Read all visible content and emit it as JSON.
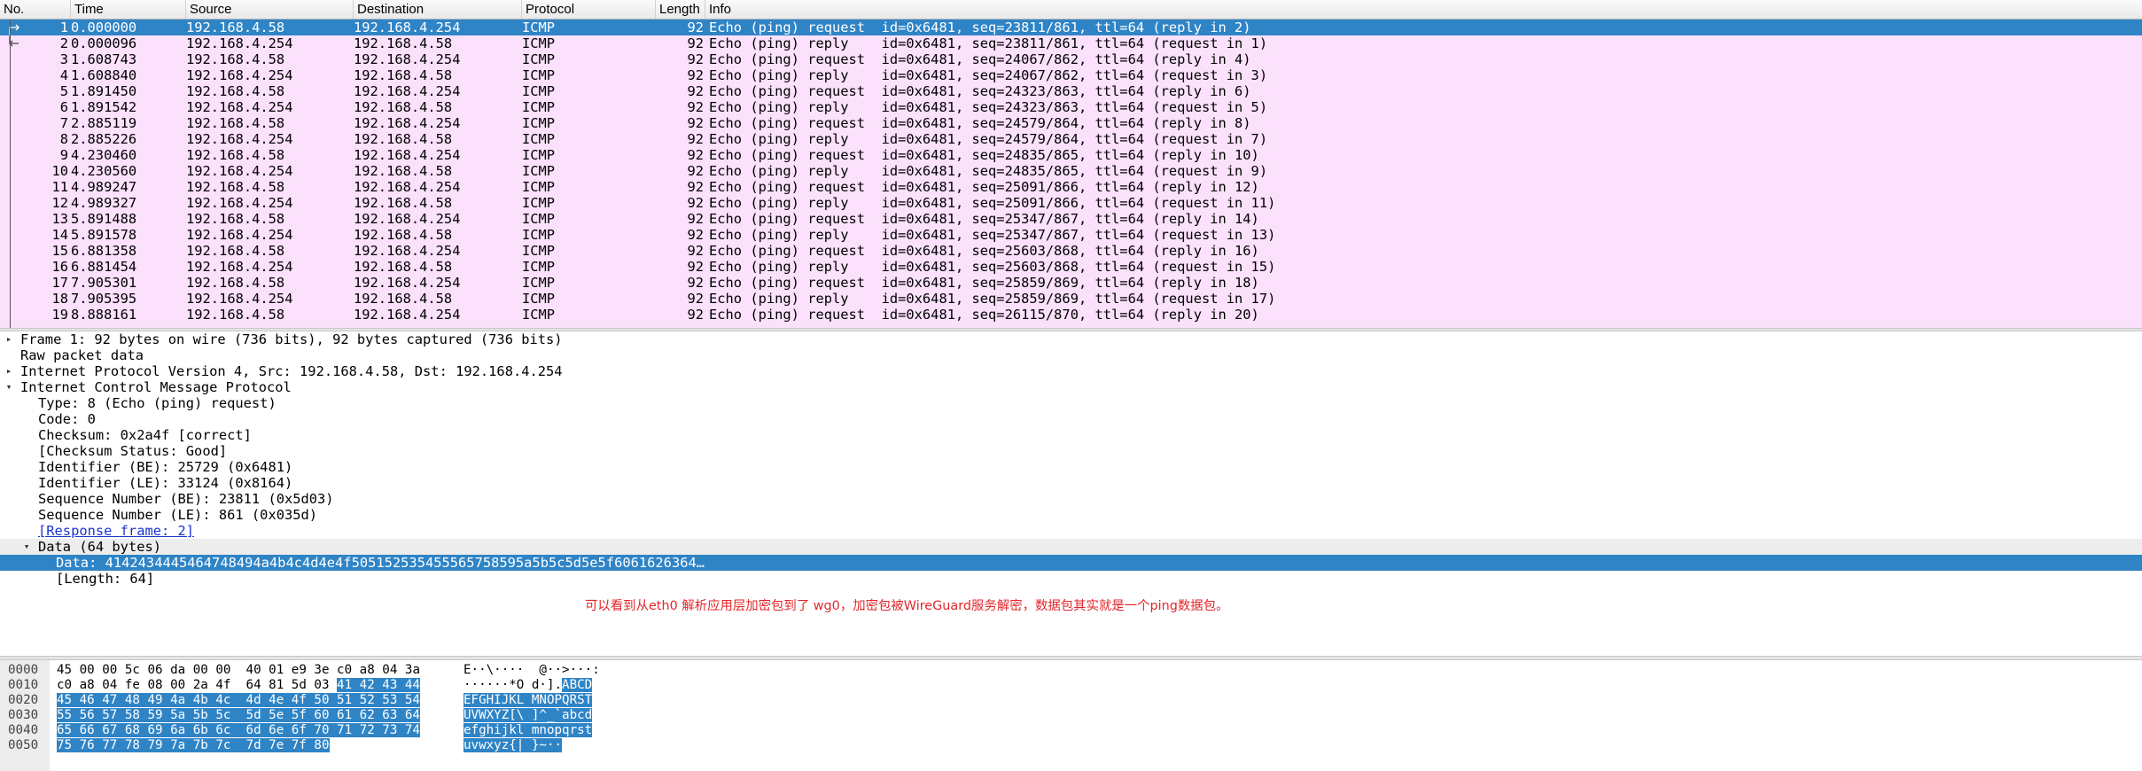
{
  "packet_list": {
    "columns": {
      "no": "No.",
      "time": "Time",
      "source": "Source",
      "destination": "Destination",
      "protocol": "Protocol",
      "length": "Length",
      "info": "Info"
    },
    "rows": [
      {
        "no": "1",
        "time": "0.000000",
        "src": "192.168.4.58",
        "dst": "192.168.4.254",
        "proto": "ICMP",
        "len": "92",
        "info": "Echo (ping) request  id=0x6481, seq=23811/861, ttl=64 (reply in 2)"
      },
      {
        "no": "2",
        "time": "0.000096",
        "src": "192.168.4.254",
        "dst": "192.168.4.58",
        "proto": "ICMP",
        "len": "92",
        "info": "Echo (ping) reply    id=0x6481, seq=23811/861, ttl=64 (request in 1)"
      },
      {
        "no": "3",
        "time": "1.608743",
        "src": "192.168.4.58",
        "dst": "192.168.4.254",
        "proto": "ICMP",
        "len": "92",
        "info": "Echo (ping) request  id=0x6481, seq=24067/862, ttl=64 (reply in 4)"
      },
      {
        "no": "4",
        "time": "1.608840",
        "src": "192.168.4.254",
        "dst": "192.168.4.58",
        "proto": "ICMP",
        "len": "92",
        "info": "Echo (ping) reply    id=0x6481, seq=24067/862, ttl=64 (request in 3)"
      },
      {
        "no": "5",
        "time": "1.891450",
        "src": "192.168.4.58",
        "dst": "192.168.4.254",
        "proto": "ICMP",
        "len": "92",
        "info": "Echo (ping) request  id=0x6481, seq=24323/863, ttl=64 (reply in 6)"
      },
      {
        "no": "6",
        "time": "1.891542",
        "src": "192.168.4.254",
        "dst": "192.168.4.58",
        "proto": "ICMP",
        "len": "92",
        "info": "Echo (ping) reply    id=0x6481, seq=24323/863, ttl=64 (request in 5)"
      },
      {
        "no": "7",
        "time": "2.885119",
        "src": "192.168.4.58",
        "dst": "192.168.4.254",
        "proto": "ICMP",
        "len": "92",
        "info": "Echo (ping) request  id=0x6481, seq=24579/864, ttl=64 (reply in 8)"
      },
      {
        "no": "8",
        "time": "2.885226",
        "src": "192.168.4.254",
        "dst": "192.168.4.58",
        "proto": "ICMP",
        "len": "92",
        "info": "Echo (ping) reply    id=0x6481, seq=24579/864, ttl=64 (request in 7)"
      },
      {
        "no": "9",
        "time": "4.230460",
        "src": "192.168.4.58",
        "dst": "192.168.4.254",
        "proto": "ICMP",
        "len": "92",
        "info": "Echo (ping) request  id=0x6481, seq=24835/865, ttl=64 (reply in 10)"
      },
      {
        "no": "10",
        "time": "4.230560",
        "src": "192.168.4.254",
        "dst": "192.168.4.58",
        "proto": "ICMP",
        "len": "92",
        "info": "Echo (ping) reply    id=0x6481, seq=24835/865, ttl=64 (request in 9)"
      },
      {
        "no": "11",
        "time": "4.989247",
        "src": "192.168.4.58",
        "dst": "192.168.4.254",
        "proto": "ICMP",
        "len": "92",
        "info": "Echo (ping) request  id=0x6481, seq=25091/866, ttl=64 (reply in 12)"
      },
      {
        "no": "12",
        "time": "4.989327",
        "src": "192.168.4.254",
        "dst": "192.168.4.58",
        "proto": "ICMP",
        "len": "92",
        "info": "Echo (ping) reply    id=0x6481, seq=25091/866, ttl=64 (request in 11)"
      },
      {
        "no": "13",
        "time": "5.891488",
        "src": "192.168.4.58",
        "dst": "192.168.4.254",
        "proto": "ICMP",
        "len": "92",
        "info": "Echo (ping) request  id=0x6481, seq=25347/867, ttl=64 (reply in 14)"
      },
      {
        "no": "14",
        "time": "5.891578",
        "src": "192.168.4.254",
        "dst": "192.168.4.58",
        "proto": "ICMP",
        "len": "92",
        "info": "Echo (ping) reply    id=0x6481, seq=25347/867, ttl=64 (request in 13)"
      },
      {
        "no": "15",
        "time": "6.881358",
        "src": "192.168.4.58",
        "dst": "192.168.4.254",
        "proto": "ICMP",
        "len": "92",
        "info": "Echo (ping) request  id=0x6481, seq=25603/868, ttl=64 (reply in 16)"
      },
      {
        "no": "16",
        "time": "6.881454",
        "src": "192.168.4.254",
        "dst": "192.168.4.58",
        "proto": "ICMP",
        "len": "92",
        "info": "Echo (ping) reply    id=0x6481, seq=25603/868, ttl=64 (request in 15)"
      },
      {
        "no": "17",
        "time": "7.905301",
        "src": "192.168.4.58",
        "dst": "192.168.4.254",
        "proto": "ICMP",
        "len": "92",
        "info": "Echo (ping) request  id=0x6481, seq=25859/869, ttl=64 (reply in 18)"
      },
      {
        "no": "18",
        "time": "7.905395",
        "src": "192.168.4.254",
        "dst": "192.168.4.58",
        "proto": "ICMP",
        "len": "92",
        "info": "Echo (ping) reply    id=0x6481, seq=25859/869, ttl=64 (request in 17)"
      },
      {
        "no": "19",
        "time": "8.888161",
        "src": "192.168.4.58",
        "dst": "192.168.4.254",
        "proto": "ICMP",
        "len": "92",
        "info": "Echo (ping) request  id=0x6481, seq=26115/870, ttl=64 (reply in 20)"
      }
    ],
    "selected_index": 0,
    "row_color": "#fbe1fb",
    "selected_color": "#2f84c6"
  },
  "details": {
    "rows": [
      {
        "indent": 0,
        "arrow": "collapsed",
        "text": "Frame 1: 92 bytes on wire (736 bits), 92 bytes captured (736 bits)"
      },
      {
        "indent": 0,
        "arrow": "none",
        "text": "Raw packet data"
      },
      {
        "indent": 0,
        "arrow": "collapsed",
        "text": "Internet Protocol Version 4, Src: 192.168.4.58, Dst: 192.168.4.254"
      },
      {
        "indent": 0,
        "arrow": "expanded",
        "text": "Internet Control Message Protocol"
      },
      {
        "indent": 1,
        "arrow": "none",
        "text": "Type: 8 (Echo (ping) request)"
      },
      {
        "indent": 1,
        "arrow": "none",
        "text": "Code: 0"
      },
      {
        "indent": 1,
        "arrow": "none",
        "text": "Checksum: 0x2a4f [correct]"
      },
      {
        "indent": 1,
        "arrow": "none",
        "text": "[Checksum Status: Good]"
      },
      {
        "indent": 1,
        "arrow": "none",
        "text": "Identifier (BE): 25729 (0x6481)"
      },
      {
        "indent": 1,
        "arrow": "none",
        "text": "Identifier (LE): 33124 (0x8164)"
      },
      {
        "indent": 1,
        "arrow": "none",
        "text": "Sequence Number (BE): 23811 (0x5d03)"
      },
      {
        "indent": 1,
        "arrow": "none",
        "text": "Sequence Number (LE): 861 (0x035d)"
      },
      {
        "indent": 1,
        "arrow": "none",
        "text": "[Response frame: 2]",
        "link": true
      },
      {
        "indent": 1,
        "arrow": "expanded",
        "text": "Data (64 bytes)",
        "highlight": true
      },
      {
        "indent": 2,
        "arrow": "none",
        "text": "Data: 4142434445464748494a4b4c4d4e4f505152535455565758595a5b5c5d5e5f6061626364…",
        "selected": true
      },
      {
        "indent": 2,
        "arrow": "none",
        "text": "[Length: 64]"
      }
    ],
    "note": "可以看到从eth0 解析应用层加密包到了 wg0，加密包被WireGuard服务解密，数据包其实就是一个ping数据包。"
  },
  "bytes": {
    "rows": [
      {
        "offset": "0000",
        "hex_plain": "45 00 00 5c 06 da 00 00  40 01 e9 3e c0 a8 04 3a",
        "hex_sel": "",
        "ascii_plain": "E··\\····  @··>···:",
        "ascii_sel": ""
      },
      {
        "offset": "0010",
        "hex_plain": "c0 a8 04 fe 08 00 2a 4f  64 81 5d 03 ",
        "hex_sel": "41 42 43 44",
        "ascii_plain": "······*O d·].",
        "ascii_sel": "ABCD"
      },
      {
        "offset": "0020",
        "hex_plain": "",
        "hex_sel": "45 46 47 48 49 4a 4b 4c  4d 4e 4f 50 51 52 53 54",
        "ascii_plain": "",
        "ascii_sel": "EFGHIJKL MNOPQRST"
      },
      {
        "offset": "0030",
        "hex_plain": "",
        "hex_sel": "55 56 57 58 59 5a 5b 5c  5d 5e 5f 60 61 62 63 64",
        "ascii_plain": "",
        "ascii_sel": "UVWXYZ[\\ ]^_`abcd"
      },
      {
        "offset": "0040",
        "hex_plain": "",
        "hex_sel": "65 66 67 68 69 6a 6b 6c  6d 6e 6f 70 71 72 73 74",
        "ascii_plain": "",
        "ascii_sel": "efghijkl mnopqrst"
      },
      {
        "offset": "0050",
        "hex_plain": "",
        "hex_sel": "75 76 77 78 79 7a 7b 7c  7d 7e 7f 80",
        "ascii_plain": "",
        "ascii_sel": "uvwxyz{| }~··"
      }
    ]
  }
}
